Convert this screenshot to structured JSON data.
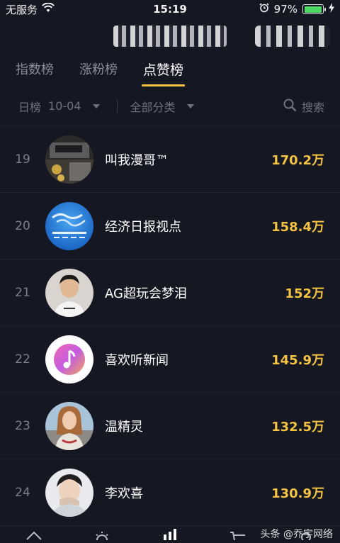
{
  "status_bar": {
    "carrier": "无服务",
    "time": "15:19",
    "battery_percent": "97%",
    "battery_level": 0.97
  },
  "tabs": [
    {
      "label": "指数榜",
      "active": false
    },
    {
      "label": "涨粉榜",
      "active": false
    },
    {
      "label": "点赞榜",
      "active": true
    }
  ],
  "filters": {
    "period_label": "日榜",
    "date": "10-04",
    "category": "全部分类",
    "search_label": "搜索"
  },
  "ranking": [
    {
      "rank": "19",
      "name": "叫我漫哥™",
      "likes": "170.2万"
    },
    {
      "rank": "20",
      "name": "经济日报视点",
      "likes": "158.4万"
    },
    {
      "rank": "21",
      "name": "AG超玩会梦泪",
      "likes": "152万"
    },
    {
      "rank": "22",
      "name": "喜欢听新闻",
      "likes": "145.9万"
    },
    {
      "rank": "23",
      "name": "温精灵",
      "likes": "132.5万"
    },
    {
      "rank": "24",
      "name": "李欢喜",
      "likes": "130.9万"
    }
  ],
  "watermark": "头条 @乔宇网络",
  "colors": {
    "background": "#151722",
    "accent": "#f5c342",
    "text_primary": "#ffffff",
    "text_secondary": "#8c8e99",
    "battery": "#4cd964"
  },
  "icons": [
    "wifi-icon",
    "alarm-icon",
    "battery-icon",
    "charging-icon",
    "caret-down-icon",
    "search-icon",
    "home-icon",
    "discover-icon",
    "chart-icon",
    "cart-icon",
    "profile-icon"
  ]
}
